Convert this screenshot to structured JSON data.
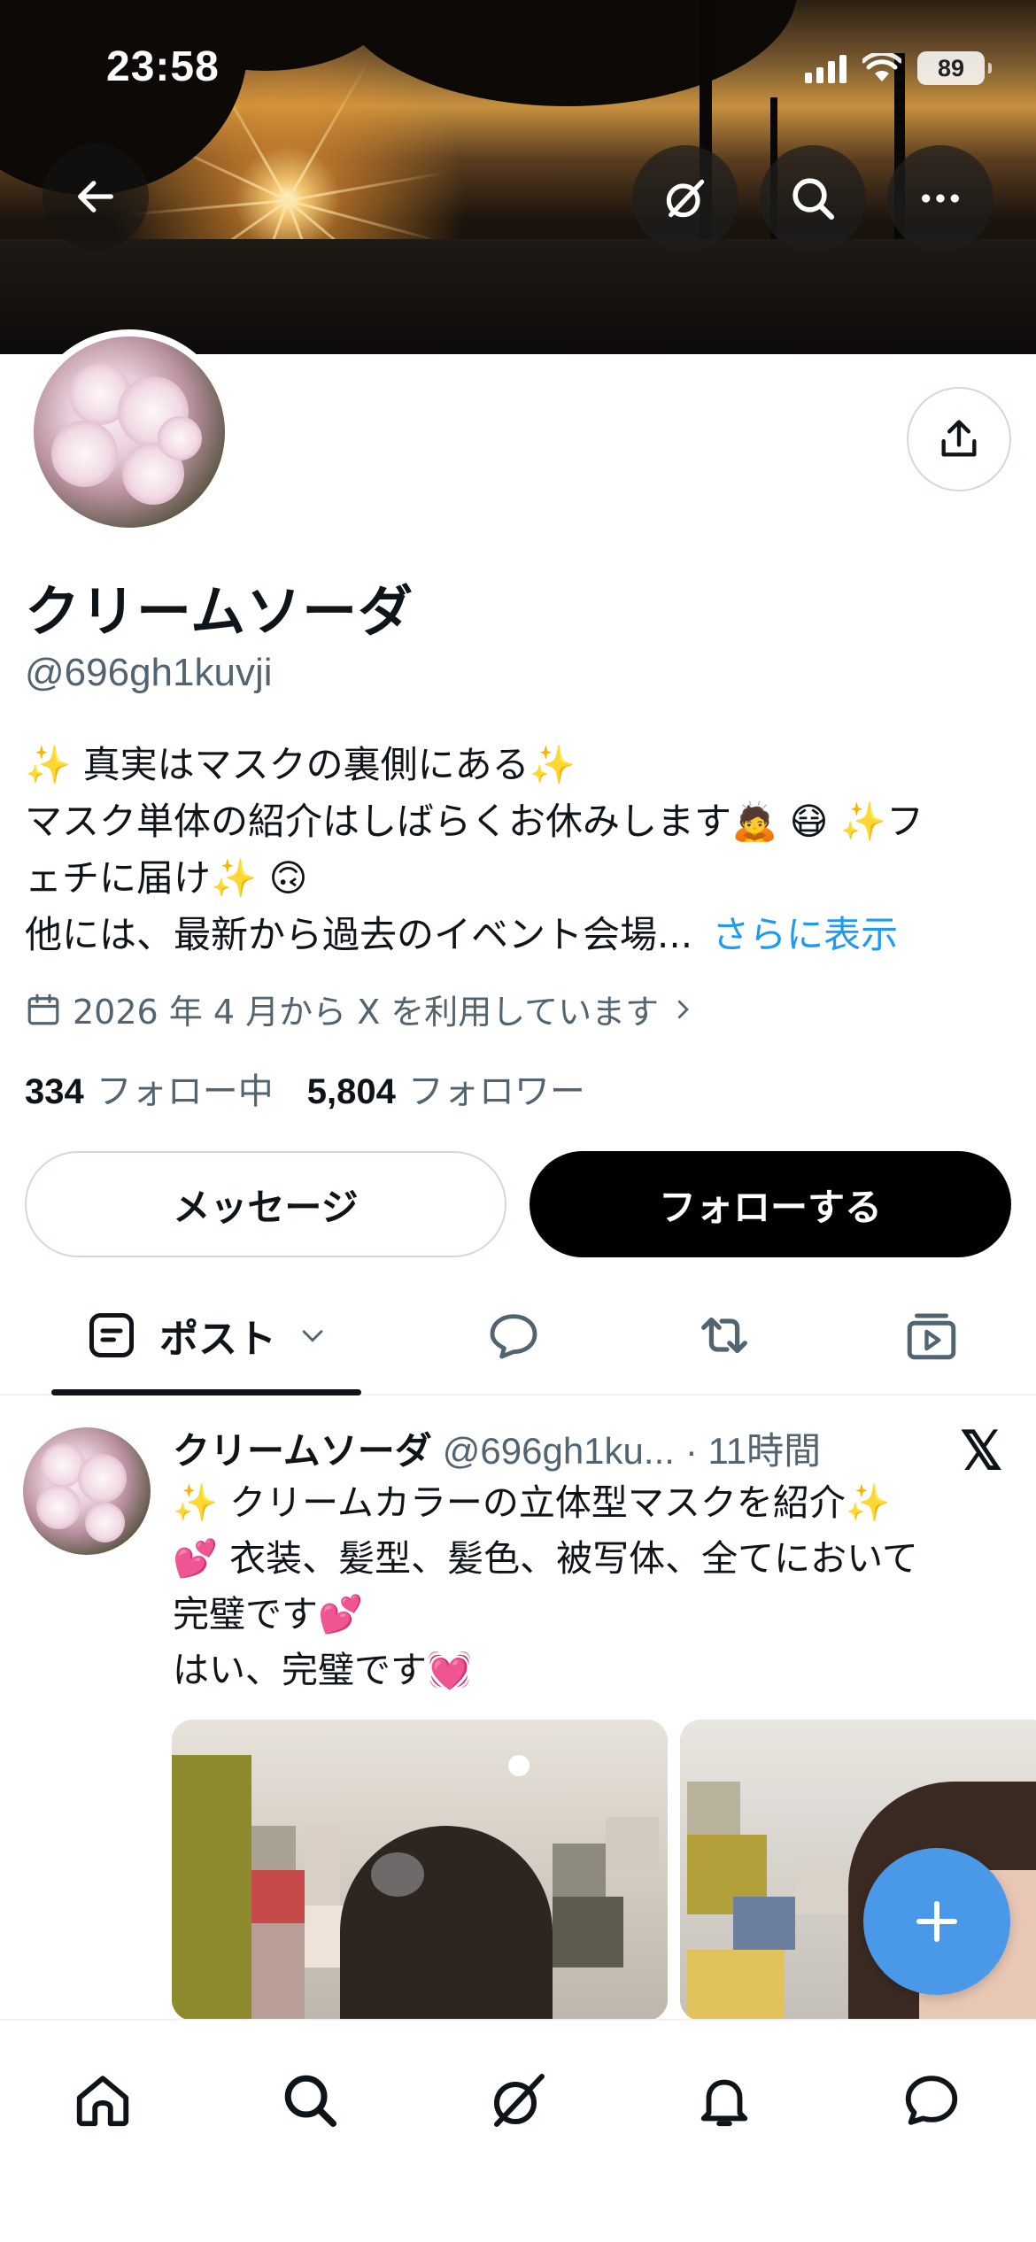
{
  "status_bar": {
    "time": "23:58",
    "battery": "89"
  },
  "header": {
    "back_icon": "arrow-left-icon",
    "grok_icon": "grok-icon",
    "search_icon": "search-icon",
    "more_icon": "more-icon",
    "share_icon": "share-icon"
  },
  "profile": {
    "display_name": "クリームソーダ",
    "handle": "@696gh1kuvji",
    "bio_lines": [
      "✨ 真実はマスクの裏側にある✨",
      "マスク単体の紹介はしばらくお休みします🙇 😷 ✨フ",
      "ェチに届け✨ 🙃",
      "他には、最新から過去のイベント会場..."
    ],
    "show_more": "さらに表示",
    "joined": "2026 年 4 月から X を利用しています",
    "following_count": "334",
    "following_label": "フォロー中",
    "followers_count": "5,804",
    "followers_label": "フォロワー"
  },
  "actions": {
    "message": "メッセージ",
    "follow": "フォローする"
  },
  "tabs": {
    "posts_label": "ポスト"
  },
  "post": {
    "author_name": "クリームソーダ",
    "author_handle": "@696gh1ku...",
    "time": "· 11時間",
    "lines": [
      "✨ クリームカラーの立体型マスクを紹介✨",
      "💕 衣装、髪型、髪色、被写体、全てにおいて",
      "完璧です💕",
      "はい、完璧です💓"
    ]
  },
  "colors": {
    "accent": "#1d9bf0",
    "fab": "#4a99e9",
    "text": "#0f1419",
    "secondary": "#536471"
  }
}
